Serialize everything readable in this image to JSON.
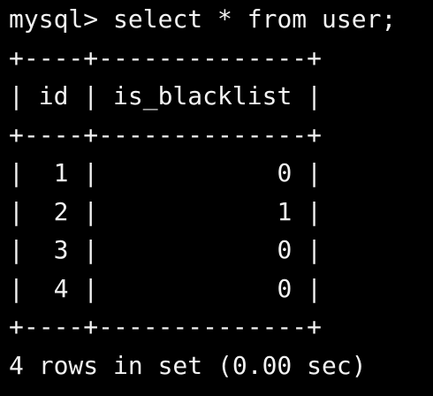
{
  "terminal": {
    "colors": {
      "background": "#000000",
      "text": "#f2f2f2"
    },
    "prompt": "mysql>",
    "command": "select * from user;",
    "border": "+----+--------------+",
    "columns": [
      "id",
      "is_blacklist"
    ],
    "rows": [
      {
        "id": "1",
        "is_blacklist": "0"
      },
      {
        "id": "2",
        "is_blacklist": "1"
      },
      {
        "id": "3",
        "is_blacklist": "0"
      },
      {
        "id": "4",
        "is_blacklist": "0"
      }
    ],
    "summary": "4 rows in set (0.00 sec)"
  }
}
